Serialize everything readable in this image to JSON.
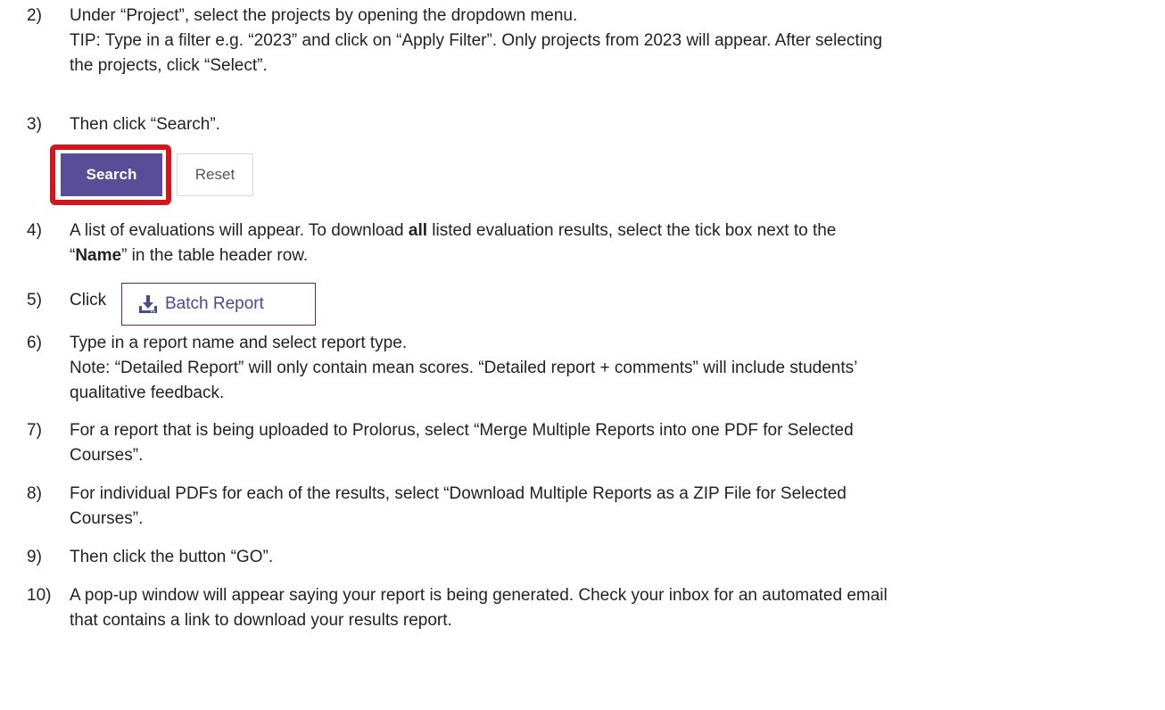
{
  "steps": [
    {
      "num": "2)",
      "lines": [
        "Under “Project”, select the projects by opening the dropdown menu.",
        "TIP: Type in a filter e.g. “2023” and click on “Apply Filter”. Only projects from 2023 will appear. After selecting",
        "the projects, click “Select”."
      ]
    },
    {
      "num": "3)",
      "lines": [
        "Then click “Search”."
      ]
    },
    {
      "num": "4)",
      "line1_a": "A list of evaluations will appear. To download ",
      "line1_bold": "all",
      "line1_b": " listed evaluation results, select the tick box next to the",
      "line2_a": "“",
      "line2_bold": "Name",
      "line2_b": "” in the table header row."
    },
    {
      "num": "5)",
      "lines": [
        "Click"
      ]
    },
    {
      "num": "6)",
      "lines": [
        "Type in a report name and select report type.",
        "Note: “Detailed Report” will only contain mean scores. “Detailed report + comments” will include students’",
        "qualitative feedback."
      ]
    },
    {
      "num": "7)",
      "lines": [
        "For a report that is being uploaded to Prolorus, select “Merge Multiple Reports into one PDF for Selected",
        "Courses”."
      ]
    },
    {
      "num": "8)",
      "lines": [
        "For individual PDFs for each of the results, select “Download Multiple Reports as a ZIP File for Selected",
        "Courses”."
      ]
    },
    {
      "num": "9)",
      "lines": [
        "Then click the button “GO”."
      ]
    },
    {
      "num": "10)",
      "lines": [
        "A pop-up window will appear saying your report is being generated. Check your inbox for an automated email",
        "that contains a link to download your results report."
      ]
    }
  ],
  "buttons": {
    "search_label": "Search",
    "reset_label": "Reset",
    "batch_label": "Batch Report",
    "batch_icon": "download-tray-icon",
    "search_bg": "#5a4d98",
    "highlight_color": "#d0161e"
  }
}
